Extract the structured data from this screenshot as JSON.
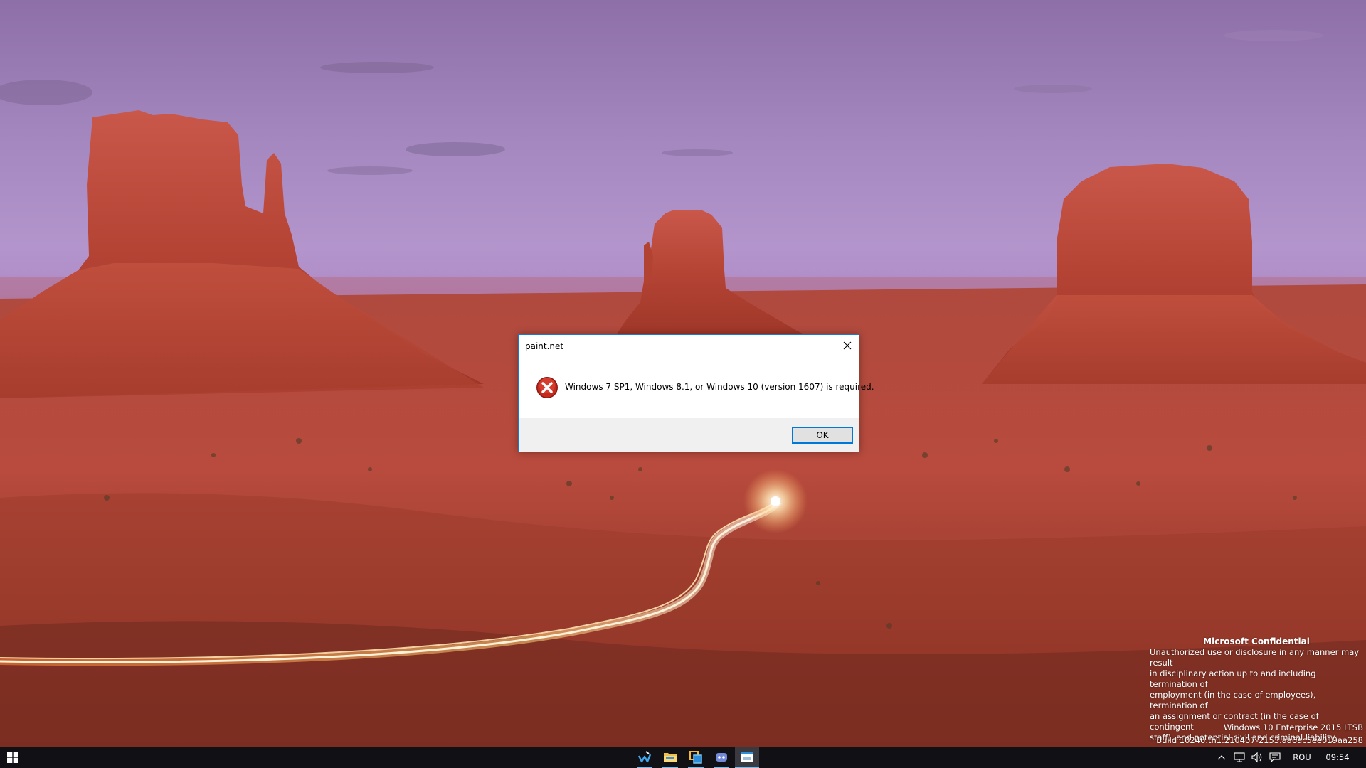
{
  "dialog": {
    "title": "paint.net",
    "message": "Windows 7 SP1, Windows 8.1, or Windows 10 (version 1607) is required.",
    "ok_label": "OK",
    "close_icon": "close-icon",
    "status_icon": "error-icon"
  },
  "watermark": {
    "title": "Microsoft Confidential",
    "line1": "Unauthorized use or disclosure in any manner may result",
    "line2": "in disciplinary action up to and including termination of",
    "line3": "employment (in the case of employees), termination of",
    "line4": "an assignment or contract (in the case of contingent",
    "line5": "staff), and potential civil and criminal liability.",
    "edition": "Windows 10 Enterprise 2015 LTSB",
    "build": "Build 10240.th1.210407-2153.aa6ac5ee019aa258"
  },
  "taskbar": {
    "apps": [
      {
        "name": "paint-net-app",
        "icon": "paint-brush-icon"
      },
      {
        "name": "file-explorer-app",
        "icon": "folder-icon"
      },
      {
        "name": "control-panel-app",
        "icon": "window-stack-icon"
      },
      {
        "name": "discord-app",
        "icon": "controller-icon"
      },
      {
        "name": "active-window-app",
        "icon": "window-icon"
      }
    ],
    "tray": {
      "language": "ROU",
      "time": "09:54"
    }
  },
  "colors": {
    "taskbar_bg": "#111015",
    "taskbar_accent": "#76b9ed",
    "dialog_border": "#1979ca",
    "error_red": "#c42b1c"
  }
}
